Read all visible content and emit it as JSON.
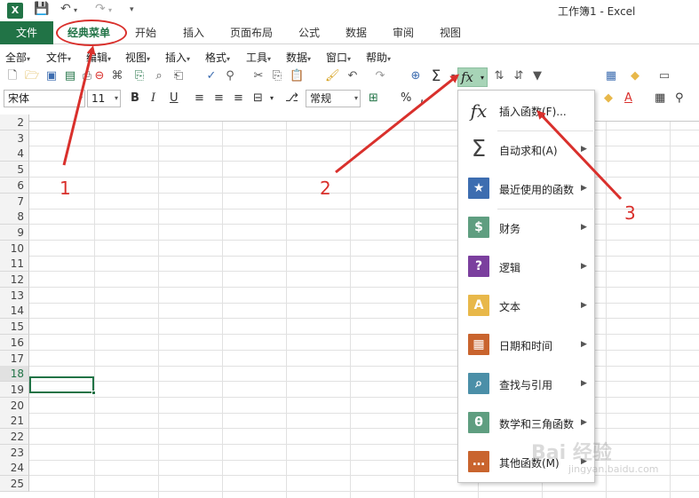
{
  "window": {
    "title": "工作簿1 - Excel",
    "logo": "X"
  },
  "quick_access": {
    "save_icon": "save-icon",
    "undo_icon": "undo-icon",
    "redo_icon": "redo-icon",
    "customize_icon": "customize-icon"
  },
  "ribbon_tabs": [
    {
      "label": "文件"
    },
    {
      "label": "经典菜单"
    },
    {
      "label": "开始"
    },
    {
      "label": "插入"
    },
    {
      "label": "页面布局"
    },
    {
      "label": "公式"
    },
    {
      "label": "数据"
    },
    {
      "label": "审阅"
    },
    {
      "label": "视图"
    }
  ],
  "classic_menu": [
    {
      "label": "全部"
    },
    {
      "label": "文件"
    },
    {
      "label": "编辑"
    },
    {
      "label": "视图"
    },
    {
      "label": "插入"
    },
    {
      "label": "格式"
    },
    {
      "label": "工具"
    },
    {
      "label": "数据"
    },
    {
      "label": "窗口"
    },
    {
      "label": "帮助"
    }
  ],
  "format_bar": {
    "font_name": "宋体",
    "font_size": "11",
    "bold": "B",
    "italic": "I",
    "underline": "U",
    "number_format": "常规",
    "percent": "%"
  },
  "function_button": {
    "label": "fx"
  },
  "row_numbers": [
    "2",
    "3",
    "4",
    "5",
    "6",
    "7",
    "8",
    "9",
    "10",
    "11",
    "12",
    "13",
    "14",
    "15",
    "16",
    "17",
    "18",
    "19",
    "20",
    "21",
    "22",
    "23",
    "24",
    "25"
  ],
  "selected_row": "18",
  "function_menu": [
    {
      "label": "插入函数(F)...",
      "icon": "fx-icon",
      "icon_text": "fx",
      "has_submenu": false
    },
    {
      "label": "自动求和(A)",
      "icon": "sigma-icon",
      "icon_text": "Σ",
      "has_submenu": true
    },
    {
      "label": "最近使用的函数",
      "icon": "star-book-icon",
      "icon_text": "★",
      "has_submenu": true
    },
    {
      "label": "财务",
      "icon": "coins-book-icon",
      "icon_text": "$",
      "has_submenu": true
    },
    {
      "label": "逻辑",
      "icon": "question-book-icon",
      "icon_text": "?",
      "has_submenu": true
    },
    {
      "label": "文本",
      "icon": "text-book-icon",
      "icon_text": "A",
      "has_submenu": true
    },
    {
      "label": "日期和时间",
      "icon": "calendar-book-icon",
      "icon_text": "▦",
      "has_submenu": true
    },
    {
      "label": "查找与引用",
      "icon": "magnifier-book-icon",
      "icon_text": "⌕",
      "has_submenu": true
    },
    {
      "label": "数学和三角函数",
      "icon": "theta-book-icon",
      "icon_text": "θ",
      "has_submenu": true
    },
    {
      "label": "其他函数(M)",
      "icon": "more-book-icon",
      "icon_text": "…",
      "has_submenu": true
    }
  ],
  "colors": {
    "excel_green": "#217346",
    "annotation_red": "#d9302c",
    "book_blue": "#3d6db0",
    "book_green": "#5f9e80",
    "book_purple": "#7b3f9e",
    "book_yellow": "#e8b84a",
    "book_orange": "#c9642e",
    "book_teal": "#4b8fa8",
    "book_brown": "#c9642e"
  },
  "annotations": [
    "1",
    "2",
    "3"
  ],
  "watermark": {
    "text": "Bai 经验",
    "url_text": "jingyan.baidu.com"
  }
}
